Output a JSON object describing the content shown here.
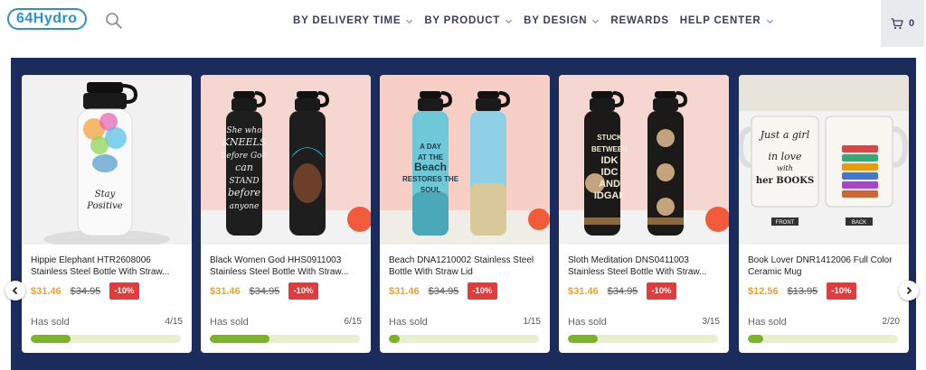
{
  "brand": {
    "logo_text": "64Hydro",
    "accent": "#2a8fd6"
  },
  "nav": [
    {
      "label": "BY DELIVERY TIME",
      "dropdown": true
    },
    {
      "label": "BY PRODUCT",
      "dropdown": true
    },
    {
      "label": "BY DESIGN",
      "dropdown": true
    },
    {
      "label": "REWARDS",
      "dropdown": false
    },
    {
      "label": "HELP CENTER",
      "dropdown": true
    }
  ],
  "cart": {
    "icon": "cart-icon",
    "count": "0"
  },
  "carousel_bg": "#1b2b5c",
  "sold_label": "Has sold",
  "products": [
    {
      "title": "Hippie Elephant HTR2608006 Stainless Steel Bottle With Straw...",
      "price": "$31.46",
      "old_price": "$34.95",
      "discount": "-10%",
      "sold": "4/15",
      "sold_fraction": 0.267,
      "image_text": [
        "Stay",
        "Positive"
      ],
      "theme": "elephant"
    },
    {
      "title": "Black Women God HHS0911003 Stainless Steel Bottle With Straw...",
      "price": "$31.46",
      "old_price": "$34.95",
      "discount": "-10%",
      "sold": "6/15",
      "sold_fraction": 0.4,
      "image_text": [
        "She who",
        "KNEELS",
        "before God",
        "can",
        "STAND",
        "before",
        "anyone"
      ],
      "theme": "black"
    },
    {
      "title": "Beach DNA1210002 Stainless Steel Bottle With Straw Lid",
      "price": "$31.46",
      "old_price": "$34.95",
      "discount": "-10%",
      "sold": "1/15",
      "sold_fraction": 0.067,
      "image_text": [
        "A DAY",
        "AT THE",
        "Beach",
        "RESTORES THE",
        "SOUL"
      ],
      "theme": "beach"
    },
    {
      "title": "Sloth Meditation DNS0411003 Stainless Steel Bottle With Straw...",
      "price": "$31.46",
      "old_price": "$34.95",
      "discount": "-10%",
      "sold": "3/15",
      "sold_fraction": 0.2,
      "image_text": [
        "STUCK",
        "BETWEEN",
        "IDK",
        "IDC",
        "AND",
        "IDGAF"
      ],
      "theme": "sloth"
    },
    {
      "title": "Book Lover DNR1412006 Full Color Ceramic Mug",
      "price": "$12.56",
      "old_price": "$13.95",
      "discount": "-10%",
      "sold": "2/20",
      "sold_fraction": 0.1,
      "image_text": [
        "Just a girl",
        "in love",
        "with",
        "her BOOKS",
        "FRONT",
        "BACK"
      ],
      "theme": "mug"
    }
  ]
}
